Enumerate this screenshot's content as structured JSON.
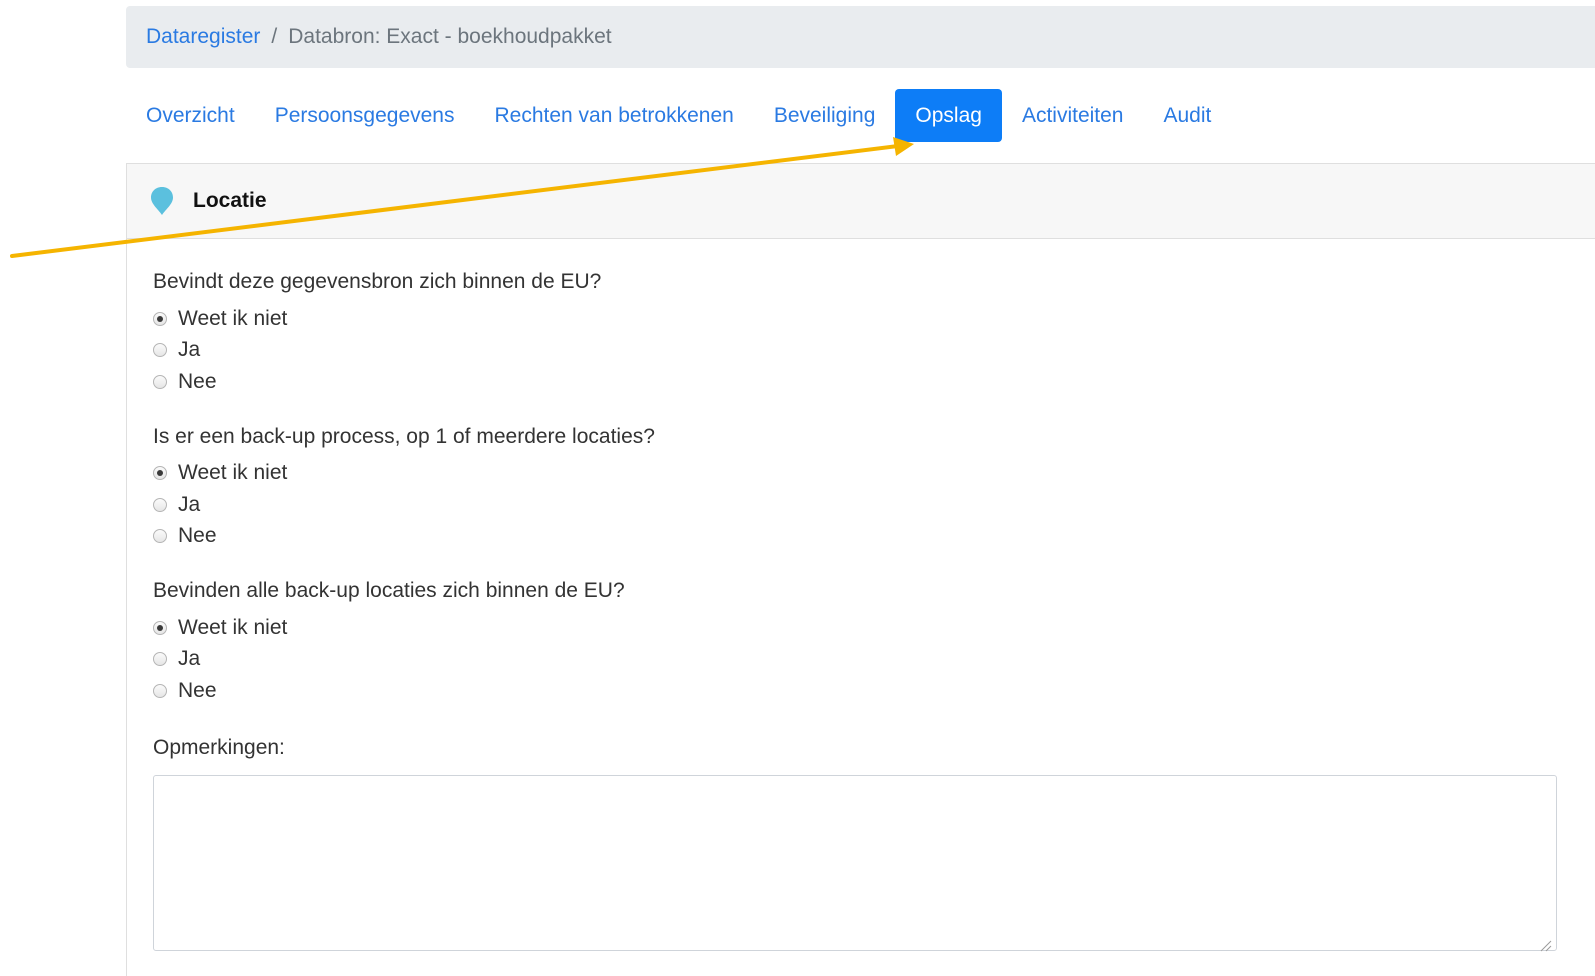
{
  "breadcrumb": {
    "root": "Dataregister",
    "separator": "/",
    "current": "Databron: Exact - boekhoudpakket"
  },
  "tabs": [
    {
      "label": "Overzicht",
      "active": false
    },
    {
      "label": "Persoonsgegevens",
      "active": false
    },
    {
      "label": "Rechten van betrokkenen",
      "active": false
    },
    {
      "label": "Beveiliging",
      "active": false
    },
    {
      "label": "Opslag",
      "active": true
    },
    {
      "label": "Activiteiten",
      "active": false
    },
    {
      "label": "Audit",
      "active": false
    }
  ],
  "card": {
    "icon": "map-pin-icon",
    "title": "Locatie",
    "questions": [
      {
        "text": "Bevindt deze gegevensbron zich binnen de EU?",
        "options": [
          "Weet ik niet",
          "Ja",
          "Nee"
        ],
        "selected": "Weet ik niet"
      },
      {
        "text": "Is er een back-up process, op 1 of meerdere locaties?",
        "options": [
          "Weet ik niet",
          "Ja",
          "Nee"
        ],
        "selected": "Weet ik niet"
      },
      {
        "text": "Bevinden alle back-up locaties zich binnen de EU?",
        "options": [
          "Weet ik niet",
          "Ja",
          "Nee"
        ],
        "selected": "Weet ik niet"
      }
    ],
    "remarks_label": "Opmerkingen:",
    "remarks_value": ""
  },
  "colors": {
    "link": "#2a7ae2",
    "active_tab": "#0d7df7",
    "pin": "#5bc0de",
    "annotation_arrow": "#f5b400"
  }
}
